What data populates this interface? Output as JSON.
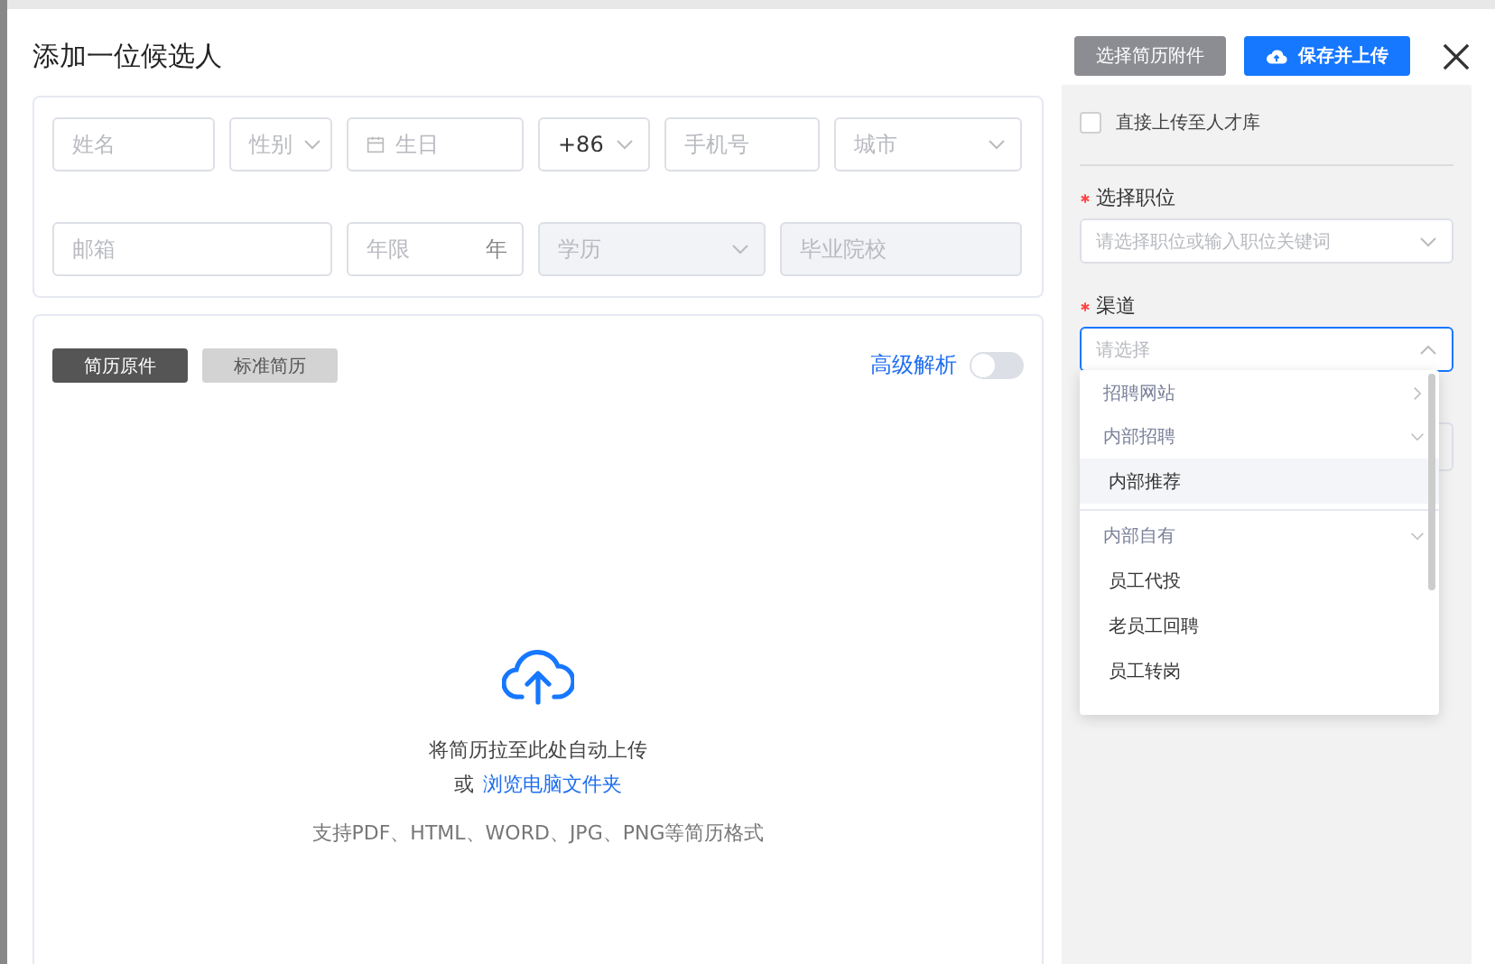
{
  "dialog": {
    "title": "添加一位候选人",
    "buttons": [
      {
        "label": "选择简历附件",
        "kind": "secondary"
      },
      {
        "label": "保存并上传",
        "kind": "primary"
      }
    ]
  },
  "form": {
    "fields": [
      {
        "kind": "text",
        "placeholder": "姓名",
        "disabled": false
      },
      {
        "kind": "select",
        "placeholder": "性别",
        "disabled": false
      },
      {
        "kind": "date",
        "placeholder": "生日",
        "disabled": false
      },
      {
        "kind": "select",
        "value": "+86",
        "disabled": false
      },
      {
        "kind": "text",
        "placeholder": "手机号",
        "disabled": false
      },
      {
        "kind": "select",
        "placeholder": "城市",
        "disabled": false
      },
      {
        "kind": "text",
        "placeholder": "邮箱",
        "disabled": false
      },
      {
        "kind": "suffix",
        "placeholder": "年限",
        "suffix": "年",
        "disabled": false
      },
      {
        "kind": "select",
        "placeholder": "学历",
        "disabled": true
      },
      {
        "kind": "text",
        "placeholder": "毕业院校",
        "disabled": true
      }
    ]
  },
  "upload": {
    "tabs": [
      {
        "label": "简历原件",
        "selected": true
      },
      {
        "label": "标准简历",
        "selected": false
      }
    ],
    "advanced": {
      "label": "高级解析",
      "on": false
    },
    "hint": "将简历拉至此处自动上传",
    "browse_prefix": "或",
    "browse_link": "浏览电脑文件夹",
    "formats": "支持PDF、HTML、WORD、JPG、PNG等简历格式"
  },
  "side": {
    "direct_upload": {
      "label": "直接上传至人才库",
      "checked": false
    },
    "position": {
      "label": "选择职位",
      "required": true,
      "placeholder": "请选择职位或输入职位关键词",
      "focused": false
    },
    "channel": {
      "label": "渠道",
      "required": true,
      "placeholder": "请选择",
      "focused": true
    },
    "channel_options": [
      {
        "label": "招聘网站",
        "expanded": false
      },
      {
        "label": "内部招聘",
        "expanded": true,
        "children": [
          {
            "label": "内部推荐",
            "selected": true
          }
        ]
      },
      {
        "label": "内部自有",
        "expanded": true,
        "children": [
          {
            "label": "员工代投",
            "selected": false
          },
          {
            "label": "老员工回聘",
            "selected": false
          },
          {
            "label": "员工转岗",
            "selected": false
          }
        ]
      }
    ]
  }
}
